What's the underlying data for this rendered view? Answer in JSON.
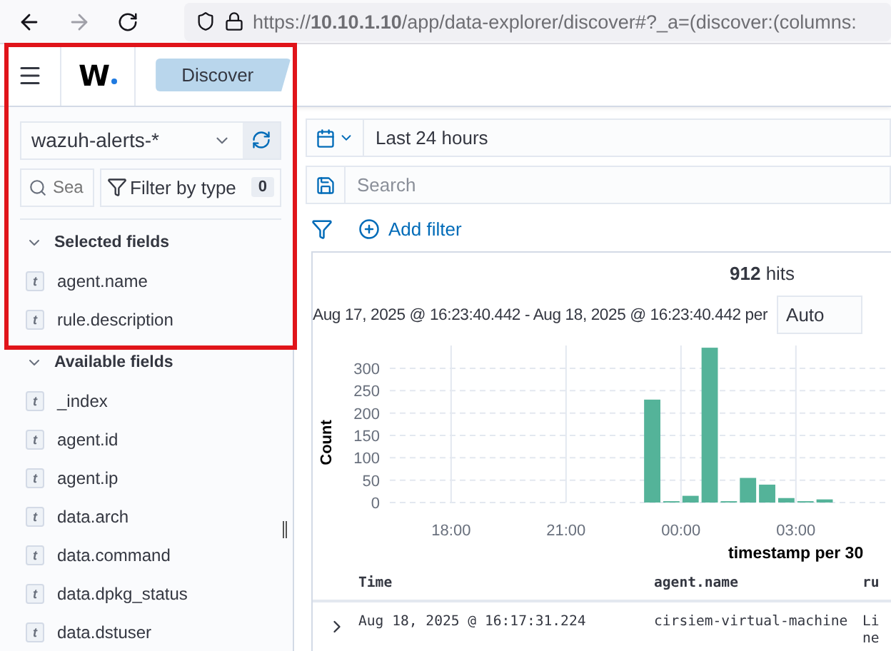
{
  "browser": {
    "url": "https://**10.10.1.10**/app/data-explorer/discover#?_a=(discover:(columns:"
  },
  "header": {
    "logo": "W",
    "breadcrumb": "Discover"
  },
  "sidebar": {
    "index_pattern": "wazuh-alerts-*",
    "search": {
      "placeholder": "Sea"
    },
    "filter_button": {
      "label": "Filter by type",
      "count": "0"
    },
    "sections": [
      {
        "title": "Selected fields",
        "expanded": true,
        "fields": [
          {
            "type": "t",
            "name": "agent.name"
          },
          {
            "type": "t",
            "name": "rule.description"
          }
        ]
      },
      {
        "title": "Available fields",
        "expanded": true,
        "fields": [
          {
            "type": "t",
            "name": "_index"
          },
          {
            "type": "t",
            "name": "agent.id"
          },
          {
            "type": "t",
            "name": "agent.ip"
          },
          {
            "type": "t",
            "name": "data.arch"
          },
          {
            "type": "t",
            "name": "data.command"
          },
          {
            "type": "t",
            "name": "data.dpkg_status"
          },
          {
            "type": "t",
            "name": "data.dstuser"
          }
        ]
      }
    ]
  },
  "toolbar": {
    "time_range": "Last 24 hours",
    "search": {
      "placeholder": "Search"
    },
    "add_filter": "Add filter"
  },
  "results": {
    "hits": "**912** hits",
    "range": "Aug 17, 2025 @ 16:23:40.442 - Aug 18, 2025 @ 16:23:40.442 per",
    "interval": "Auto",
    "chart_data": {
      "type": "bar",
      "xlabel": "timestamp per 30",
      "ylabel": "Count",
      "x": [
        "2025-08-17T23:15",
        "2025-08-17T23:45",
        "2025-08-18T00:15",
        "2025-08-18T00:45",
        "2025-08-18T01:15",
        "2025-08-18T01:45",
        "2025-08-18T02:15",
        "2025-08-18T02:45",
        "2025-08-18T03:15",
        "2025-08-18T03:45"
      ],
      "values": [
        230,
        3,
        15,
        346,
        3,
        55,
        40,
        10,
        3,
        7
      ],
      "xlim": [
        "2025-08-17T16:24",
        "2025-08-18T05:20"
      ],
      "ylim": [
        0,
        350
      ],
      "grid": true,
      "xticks": [
        {
          "value": "2025-08-17T18:00",
          "label": "18:00"
        },
        {
          "value": "2025-08-17T21:00",
          "label": "21:00"
        },
        {
          "value": "2025-08-18T00:00",
          "label": "00:00"
        },
        {
          "value": "2025-08-18T03:00",
          "label": "03:00"
        }
      ],
      "yticks": [
        0,
        50,
        100,
        150,
        200,
        250,
        300
      ]
    },
    "table": {
      "columns": [
        "Time",
        "agent.name",
        "ru"
      ],
      "rows": [
        {
          "expanded": false,
          "cells": [
            "Aug 18, 2025 @ 16:17:31.224",
            "cirsiem-virtual-machine",
            "Li\nne"
          ]
        }
      ]
    }
  }
}
